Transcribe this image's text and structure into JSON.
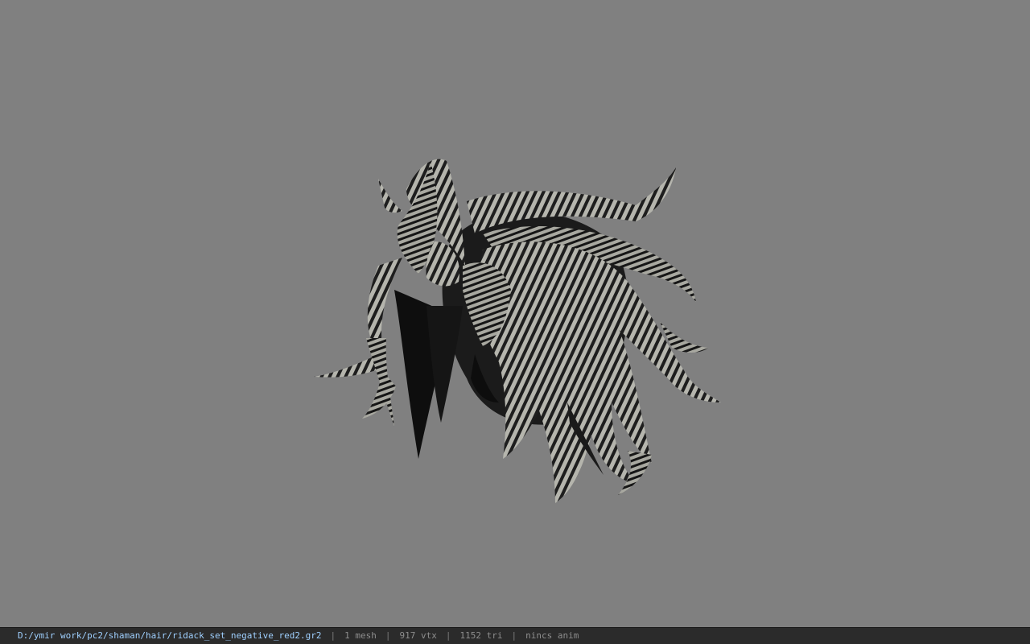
{
  "viewport": {
    "background_color": "#808080",
    "model_description_icon": "hair-mesh-model"
  },
  "statusbar": {
    "file_path": "D:/ymir work/pc2/shaman/hair/ridack_set_negative_red2.gr2",
    "separator": "|",
    "mesh_count": "1 mesh",
    "vertex_count": "917 vtx",
    "triangle_count": "1152 tri",
    "anim_status": "nincs anim"
  },
  "colors": {
    "status_bg": "#2b2b2b",
    "path_text": "#9fd0ff",
    "info_text": "#8e8e8e"
  }
}
